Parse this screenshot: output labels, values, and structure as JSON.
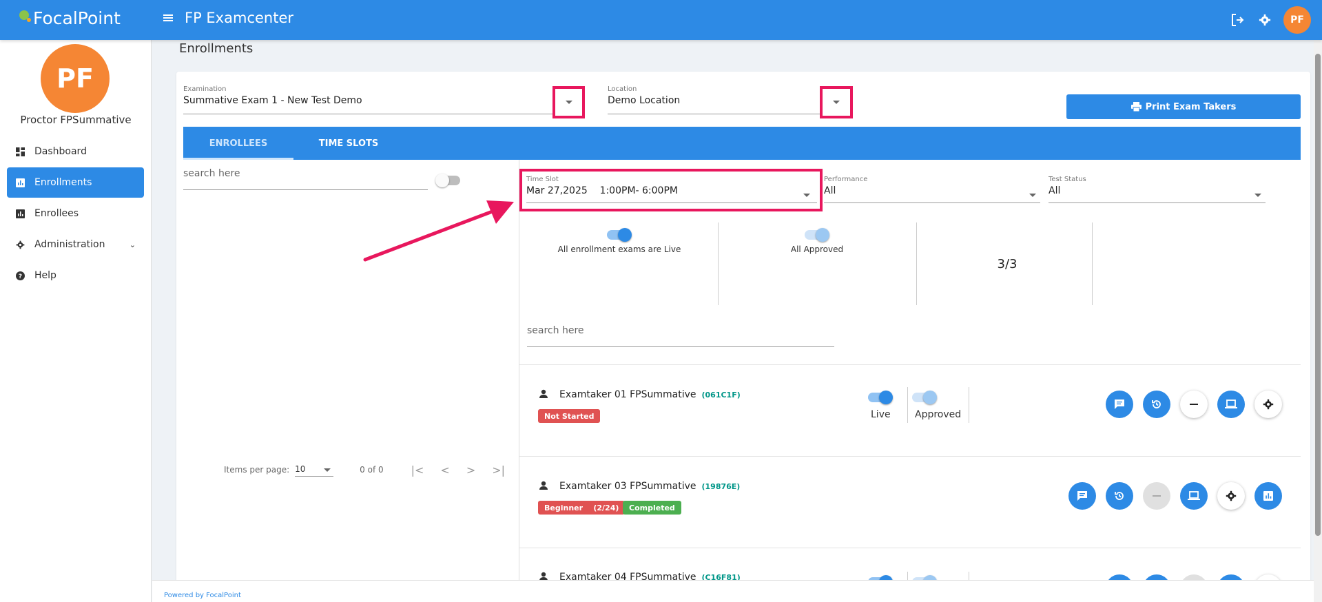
{
  "topbar": {
    "brand": "FocalPoint",
    "app_title": "FP Examcenter",
    "avatar_initials": "PF",
    "icons": [
      "logout-icon",
      "gear-icon"
    ]
  },
  "sidebar": {
    "avatar_initials": "PF",
    "user_name": "Proctor FPSummative",
    "items": [
      {
        "label": "Dashboard",
        "icon": "dashboard-icon",
        "active": false
      },
      {
        "label": "Enrollments",
        "icon": "chart-icon",
        "active": true
      },
      {
        "label": "Enrollees",
        "icon": "chart-icon",
        "active": false
      },
      {
        "label": "Administration",
        "icon": "gear-icon",
        "active": false
      },
      {
        "label": "Help",
        "icon": "help-icon",
        "active": false
      }
    ]
  },
  "main": {
    "page_title": "Enrollments",
    "examination": {
      "label": "Examination",
      "value": "Summative Exam 1 - New Test Demo"
    },
    "location": {
      "label": "Location",
      "value": "Demo Location"
    },
    "print_button": "Print Exam Takers",
    "tabs": [
      {
        "label": "ENROLLEES",
        "active": true
      },
      {
        "label": "TIME SLOTS",
        "active": false
      }
    ],
    "left_search_placeholder": "search here",
    "pager": {
      "items_per_page_label": "Items per page:",
      "items_per_page": "10",
      "count": "0 of 0"
    },
    "time_slot": {
      "label": "Time Slot",
      "value": "Mar 27,2025    1:00PM- 6:00PM"
    },
    "performance": {
      "label": "Performance",
      "value": "All"
    },
    "test_status": {
      "label": "Test Status",
      "value": "All"
    },
    "stats": {
      "live_label": "All enrollment exams are Live",
      "approved_label": "All Approved",
      "ratio": "3/3"
    },
    "right_search_placeholder": "search here",
    "examtakers": [
      {
        "name": "Examtaker 01 FPSummative",
        "code": "(061C1F)",
        "badges": [
          {
            "text": "Not Started",
            "color": "#e05252"
          }
        ],
        "live_label": "Live",
        "approved_label": "Approved"
      },
      {
        "name": "Examtaker 03 FPSummative",
        "code": "(19876E)",
        "badges": [
          {
            "text": "Beginner    (2/24)",
            "color": "#e05252"
          },
          {
            "text": "Completed",
            "color": "#4caf50"
          }
        ]
      },
      {
        "name": "Examtaker 04 FPSummative",
        "code": "(C16F81)",
        "badges": []
      }
    ]
  },
  "footer": {
    "text": "Powered by FocalPoint"
  },
  "colors": {
    "primary": "#2d8ae5",
    "highlight": "#e8175d",
    "avatar": "#f58634",
    "code": "#009688"
  }
}
